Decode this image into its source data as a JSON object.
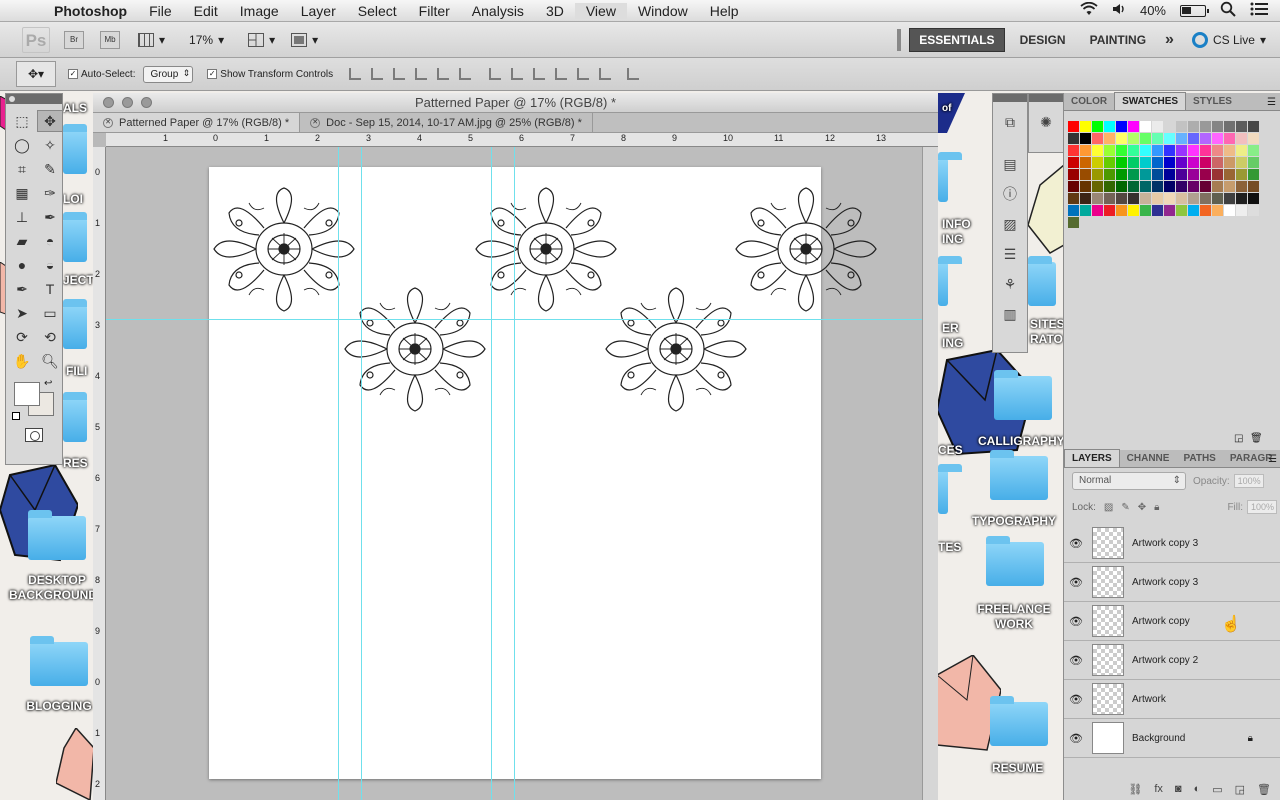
{
  "menubar": {
    "app": "Photoshop",
    "items": [
      "File",
      "Edit",
      "Image",
      "Layer",
      "Select",
      "Filter",
      "Analysis",
      "3D",
      "View",
      "Window",
      "Help"
    ],
    "highlighted": "View",
    "battery": "40%"
  },
  "appbar": {
    "logo": "Ps",
    "bridge": "Br",
    "minibridge": "Mb",
    "zoom": "17%",
    "workspaces": [
      "ESSENTIALS",
      "DESIGN",
      "PAINTING"
    ],
    "active_workspace": "ESSENTIALS",
    "more": "»",
    "cslive": "CS Live"
  },
  "options": {
    "auto_select_label": "Auto-Select:",
    "auto_select_value": "Group",
    "show_transform_label": "Show Transform Controls"
  },
  "desktop": {
    "left_labels": [
      "ALS",
      "LOI",
      "JECT",
      "FILI",
      "RES",
      "DESKTOP BACKGROUNDS",
      "BLOGGING"
    ],
    "right_labels": [
      "INFO",
      "ING",
      "ER",
      "ING",
      "SITES",
      "RATO",
      "CES",
      "TES",
      "CALLIGRAPHY",
      "TYPOGRAPHY",
      "FREELANCE WORK",
      "RESUME",
      "of"
    ]
  },
  "document": {
    "title": "Patterned Paper @ 17% (RGB/8) *",
    "tabs": [
      {
        "label": "Patterned Paper @ 17% (RGB/8) *",
        "active": true
      },
      {
        "label": "Doc - Sep 15, 2014, 10-17 AM.jpg @ 25% (RGB/8) *",
        "active": false
      }
    ],
    "ruler_h": [
      "1",
      "0",
      "1",
      "2",
      "3",
      "4",
      "5",
      "6",
      "7",
      "8",
      "9",
      "10",
      "11",
      "12",
      "13"
    ],
    "ruler_v": [
      "0",
      "1",
      "2",
      "3",
      "4",
      "5",
      "6",
      "7",
      "8",
      "9",
      "0",
      "1",
      "2"
    ]
  },
  "panels": {
    "top_tabs": [
      "COLOR",
      "SWATCHES",
      "STYLES"
    ],
    "top_active": "SWATCHES",
    "layer_tabs": [
      "LAYERS",
      "CHANNE",
      "PATHS",
      "PARAGR"
    ],
    "layer_active": "LAYERS",
    "blend_mode": "Normal",
    "opacity_label": "Opacity:",
    "opacity_value": "100%",
    "lock_label": "Lock:",
    "fill_label": "Fill:",
    "fill_value": "100%",
    "layers": [
      {
        "name": "Artwork copy 3",
        "thumb": "transparent"
      },
      {
        "name": "Artwork copy 3",
        "thumb": "transparent"
      },
      {
        "name": "Artwork copy",
        "thumb": "transparent"
      },
      {
        "name": "Artwork copy 2",
        "thumb": "transparent"
      },
      {
        "name": "Artwork",
        "thumb": "transparent"
      },
      {
        "name": "Background",
        "thumb": "white",
        "locked": true
      }
    ]
  },
  "swatches": [
    "#ff0000",
    "#ffff00",
    "#00ff00",
    "#00ffff",
    "#0000ff",
    "#ff00ff",
    "#ffffff",
    "#ebebeb",
    "#d6d6d6",
    "#c2c2c2",
    "#adadad",
    "#999999",
    "#858585",
    "#707070",
    "#5c5c5c",
    "#474747",
    "#333333",
    "#000000",
    "#ff6666",
    "#ffb266",
    "#ffff66",
    "#b2ff66",
    "#66ff66",
    "#66ffb2",
    "#66ffff",
    "#66b2ff",
    "#6666ff",
    "#b266ff",
    "#ff66ff",
    "#ff66b2",
    "#f2bfbf",
    "#f2dbbf",
    "#ff3333",
    "#ff9933",
    "#ffff33",
    "#99ff33",
    "#33ff33",
    "#33ff99",
    "#33ffff",
    "#3399ff",
    "#3333ff",
    "#9933ff",
    "#ff33ff",
    "#ff3399",
    "#e88",
    "#eb8",
    "#ee8",
    "#8e8",
    "#cc0000",
    "#cc6600",
    "#cccc00",
    "#66cc00",
    "#00cc00",
    "#00cc66",
    "#00cccc",
    "#0066cc",
    "#0000cc",
    "#6600cc",
    "#cc00cc",
    "#cc0066",
    "#c66",
    "#c96",
    "#cc6",
    "#6c6",
    "#990000",
    "#994c00",
    "#999900",
    "#4c9900",
    "#009900",
    "#00994c",
    "#009999",
    "#004c99",
    "#000099",
    "#4c0099",
    "#990099",
    "#99004c",
    "#933",
    "#963",
    "#993",
    "#393",
    "#660000",
    "#663300",
    "#666600",
    "#336600",
    "#006600",
    "#006633",
    "#006666",
    "#003366",
    "#000066",
    "#330066",
    "#660066",
    "#660033",
    "#a67c52",
    "#c69c6d",
    "#8c6239",
    "#754c24",
    "#603913",
    "#3c2415",
    "#998675",
    "#736357",
    "#534741",
    "#362f2d",
    "#c7b299",
    "#e6cba7",
    "#f0d8b8",
    "#d8c0a0",
    "#b0a090",
    "#807060",
    "#606050",
    "#404040",
    "#202020",
    "#101010",
    "#0072bc",
    "#00a99d",
    "#ec008c",
    "#ed1c24",
    "#f7941d",
    "#fff200",
    "#39b54a",
    "#2e3192",
    "#92278f",
    "#8dc63f",
    "#00aeef",
    "#f26522",
    "#fbaf5d",
    "#fff",
    "#eee",
    "#ddd",
    "#556b2f"
  ]
}
